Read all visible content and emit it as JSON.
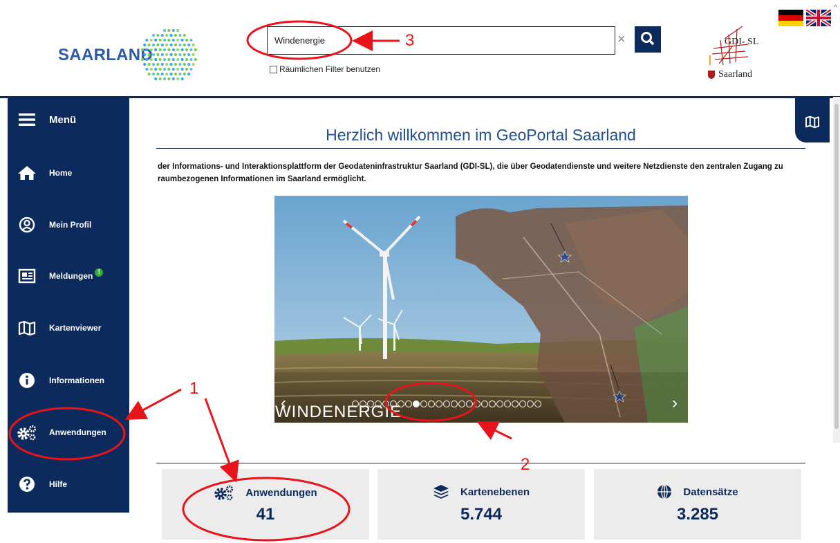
{
  "header": {
    "logo_text": "SAARLAND",
    "search": {
      "value": "Windenergie",
      "placeholder": ""
    },
    "clear_symbol": "×",
    "filter_label": "Räumlichen Filter benutzen",
    "gdi_logo": {
      "title": "GDI- SL",
      "subtitle": "Saarland"
    },
    "languages": [
      "de",
      "en"
    ],
    "accent_color": "#0d2a5c"
  },
  "sidebar": {
    "menu_label": "Menü",
    "items": [
      {
        "label": "Home",
        "icon": "home-icon"
      },
      {
        "label": "Mein Profil",
        "icon": "user-circle-icon"
      },
      {
        "label": "Meldungen",
        "icon": "newspaper-icon",
        "badge": "!"
      },
      {
        "label": "Kartenviewer",
        "icon": "map-icon"
      },
      {
        "label": "Informationen",
        "icon": "info-icon"
      },
      {
        "label": "Anwendungen",
        "icon": "gears-icon"
      },
      {
        "label": "Hilfe",
        "icon": "help-icon"
      }
    ]
  },
  "main": {
    "title": "Herzlich willkommen im GeoPortal Saarland",
    "intro": "der Informations- und Interaktionsplattform der Geodateninfrastruktur Saarland (GDI-SL), die über Geodatendienste und weitere Netzdienste den zentralen Zugang zu raumbezogenen Informationen im Saarland ermöglicht.",
    "slider": {
      "caption": "WINDENERGIE",
      "prev": "‹",
      "next": "›",
      "total_slides": 25,
      "active_slide": 8
    },
    "stats": [
      {
        "label": "Anwendungen",
        "value": "41",
        "icon": "gears-icon"
      },
      {
        "label": "Kartenebenen",
        "value": "5.744",
        "icon": "layers-icon"
      },
      {
        "label": "Datensätze",
        "value": "3.285",
        "icon": "globe-icon"
      }
    ]
  },
  "annotations": {
    "labels": [
      "1",
      "2",
      "3"
    ],
    "color": "#e8141b"
  }
}
